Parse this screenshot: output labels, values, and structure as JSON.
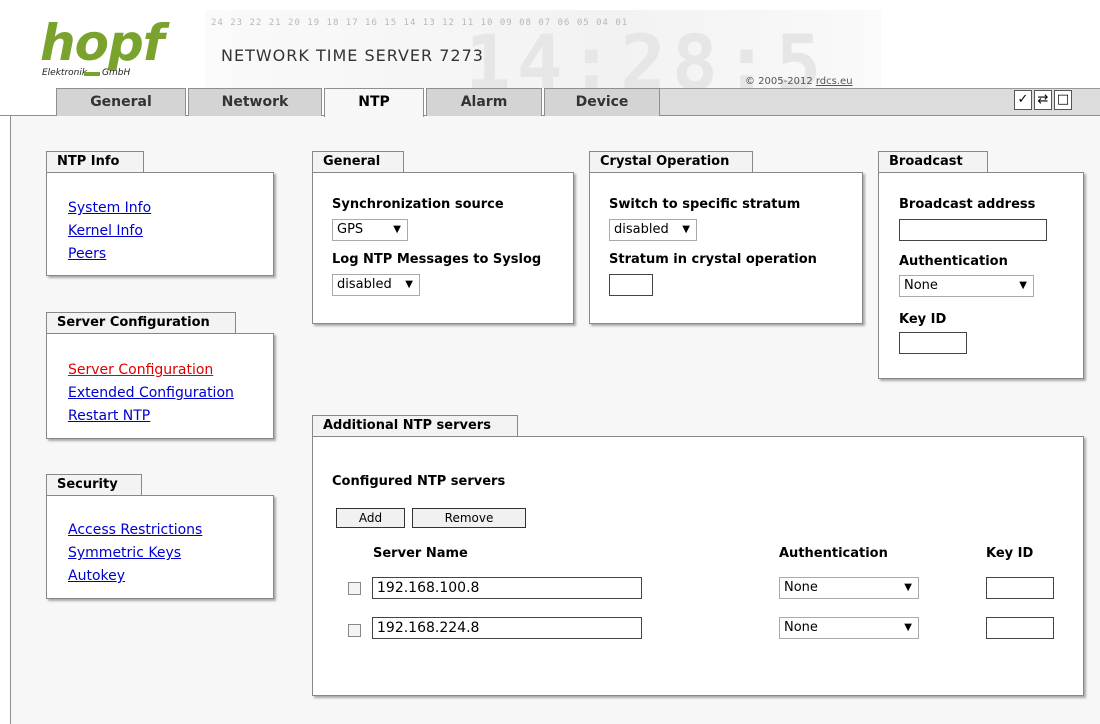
{
  "header": {
    "logo_text": "hopf",
    "logo_sub_left": "Elektronik",
    "logo_sub_right": "GmbH",
    "banner_numbers": "24 23 22 21 20 19 18 17 16 15 14 13 12 11 10 09 08 07 06 05 04 01",
    "banner_big": "14:28:5",
    "title": "NETWORK TIME SERVER 7273",
    "copyright": "© 2005-2012 ",
    "copyright_link": "rdcs.eu"
  },
  "tabs": [
    {
      "label": "General"
    },
    {
      "label": "Network"
    },
    {
      "label": "NTP"
    },
    {
      "label": "Alarm"
    },
    {
      "label": "Device"
    }
  ],
  "toolbar": {
    "icon_1": "✓",
    "icon_2": "⇄",
    "icon_3": "□"
  },
  "ntp_info": {
    "title": "NTP Info",
    "items": [
      {
        "label": "System Info"
      },
      {
        "label": "Kernel Info"
      },
      {
        "label": "Peers"
      }
    ]
  },
  "server_config": {
    "title": "Server Configuration",
    "items": [
      {
        "label": "Server Configuration"
      },
      {
        "label": "Extended Configuration"
      },
      {
        "label": "Restart NTP"
      }
    ]
  },
  "security": {
    "title": "Security",
    "items": [
      {
        "label": "Access Restrictions"
      },
      {
        "label": "Symmetric Keys"
      },
      {
        "label": "Autokey"
      }
    ]
  },
  "general": {
    "title": "General",
    "sync_label": "Synchronization source",
    "sync_value": "GPS",
    "log_label": "Log NTP Messages to Syslog",
    "log_value": "disabled"
  },
  "crystal": {
    "title": "Crystal Operation",
    "switch_label": "Switch to specific stratum",
    "switch_value": "disabled",
    "stratum_label": "Stratum in crystal operation",
    "stratum_value": ""
  },
  "broadcast": {
    "title": "Broadcast",
    "address_label": "Broadcast address",
    "address_value": "",
    "auth_label": "Authentication",
    "auth_value": "None",
    "keyid_label": "Key ID",
    "keyid_value": ""
  },
  "additional": {
    "title": "Additional NTP servers",
    "subtitle": "Configured NTP servers",
    "add_label": "Add",
    "remove_label": "Remove",
    "col_server": "Server Name",
    "col_auth": "Authentication",
    "col_keyid": "Key ID",
    "rows": [
      {
        "server": "192.168.100.8",
        "auth": "None",
        "keyid": ""
      },
      {
        "server": "192.168.224.8",
        "auth": "None",
        "keyid": ""
      }
    ]
  },
  "colors": {
    "logo_green": "#7aa32e",
    "link_blue": "#0000cc",
    "active_link_red": "#e00000"
  }
}
